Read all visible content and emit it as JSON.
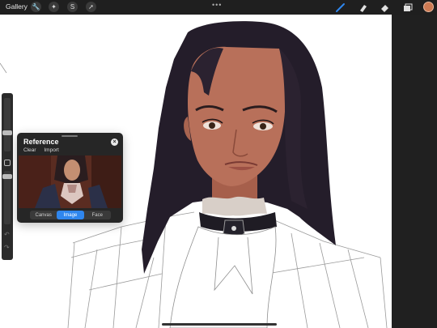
{
  "app": {
    "gallery_label": "Gallery",
    "more_label": "•••"
  },
  "toolbar_left": [
    {
      "name": "wrench-icon",
      "glyph": "🔧"
    },
    {
      "name": "adjustments-icon",
      "glyph": "✦"
    },
    {
      "name": "selection-icon",
      "glyph": "S"
    },
    {
      "name": "transform-icon",
      "glyph": "➚"
    }
  ],
  "toolbar_right": [
    {
      "name": "brush-icon"
    },
    {
      "name": "smudge-icon"
    },
    {
      "name": "eraser-icon"
    },
    {
      "name": "layers-icon"
    }
  ],
  "colors": {
    "active_color": "#cd7a53",
    "accent": "#2f86ee",
    "hair": "#241d2a",
    "skin": "#b8705a"
  },
  "reference": {
    "title": "Reference",
    "clear_label": "Clear",
    "import_label": "Import",
    "close_glyph": "×",
    "tabs": [
      {
        "label": "Canvas",
        "active": false
      },
      {
        "label": "Image",
        "active": true
      },
      {
        "label": "Face",
        "active": false
      }
    ]
  }
}
